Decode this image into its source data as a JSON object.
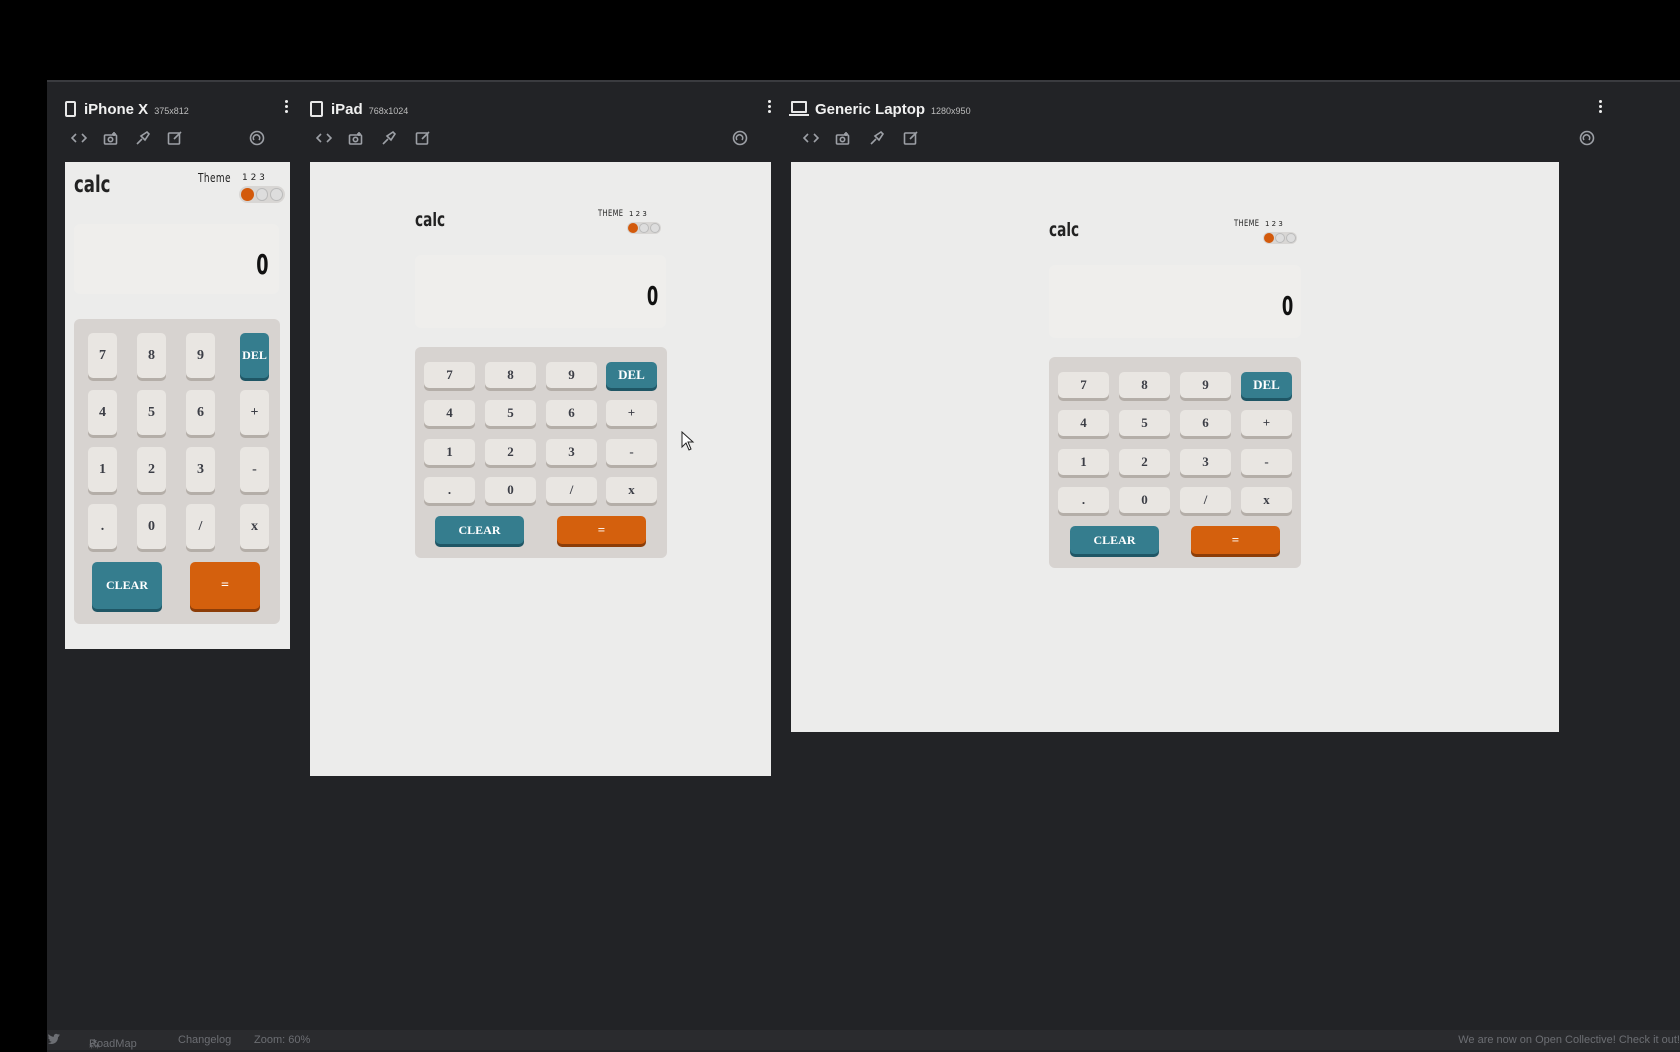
{
  "devices": [
    {
      "name": "iPhone X",
      "size": "375x812"
    },
    {
      "name": "iPad",
      "size": "768x1024"
    },
    {
      "name": "Generic Laptop",
      "size": "1280x950"
    }
  ],
  "calculator": {
    "title": "calc",
    "theme_label_phone": "Theme",
    "theme_label_wide": "THEME",
    "theme_numbers": "1 2 3",
    "active_theme": 1,
    "display_value": "0",
    "keys": [
      "7",
      "8",
      "9",
      "DEL",
      "4",
      "5",
      "6",
      "+",
      "1",
      "2",
      "3",
      "-",
      ".",
      "0",
      "/",
      "x"
    ],
    "clear_label": "CLEAR",
    "equals_label": "=",
    "colors": {
      "accent_teal": "#357d8e",
      "accent_orange": "#d4600d",
      "background": "#ececeb"
    }
  },
  "status_bar": {
    "roadmap": "RoadMap",
    "changelog": "Changelog",
    "zoom": "Zoom: 60%",
    "announcement": "We are now on Open Collective! Check it out!"
  }
}
